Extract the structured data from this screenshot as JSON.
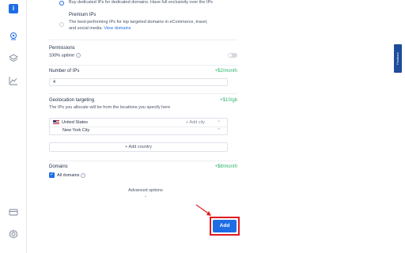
{
  "sidebar": {
    "logo_text": "i",
    "items": [
      {
        "name": "location-icon"
      },
      {
        "name": "layers-icon"
      },
      {
        "name": "chart-icon"
      },
      {
        "name": "card-icon"
      },
      {
        "name": "settings-icon"
      }
    ]
  },
  "options": {
    "dedicated_desc": "Buy dedicated IPs for dedicated domains. Have full exclusivity over the IPs",
    "premium_title": "Premium IPs",
    "premium_desc_line1": "The best-performing IPs for top targeted domains in eCommerce, travel,",
    "premium_desc_line2": "and social media.",
    "premium_link": "View domains"
  },
  "permissions": {
    "title": "Permissions",
    "uptime_label": "100% uptime"
  },
  "num_ips": {
    "title": "Number of IPs",
    "price": "+$2/month",
    "value": "4"
  },
  "geo": {
    "title": "Geolocation targeting",
    "price": "+$10/gb",
    "desc": "The IPs you allocate will be from the locations you specify here",
    "country": "United States",
    "add_city": "+ Add city",
    "city": "New York City",
    "add_country": "+ Add country"
  },
  "domains": {
    "title": "Domains",
    "price": "+$8/month",
    "all_label": "All domains"
  },
  "advanced": {
    "label": "Advanced options"
  },
  "add_button": {
    "label": "Add"
  },
  "feedback": {
    "label": "Feedback"
  },
  "colors": {
    "accent": "#1e6de5",
    "price_green": "#2eb36b",
    "highlight_red": "#e11b22"
  }
}
